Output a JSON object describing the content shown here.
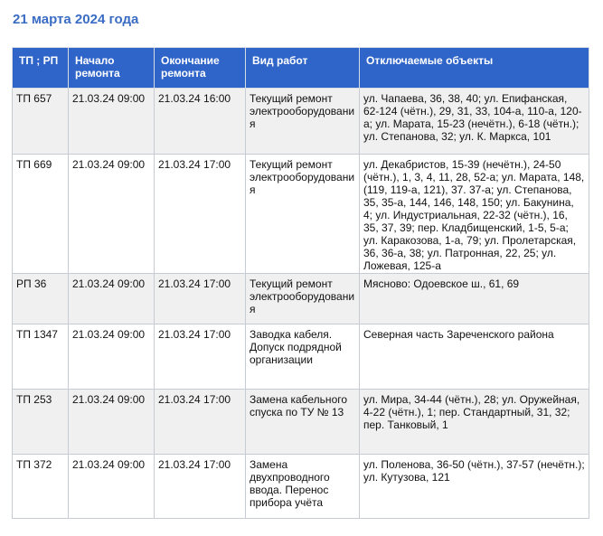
{
  "title": "21 марта 2024 года",
  "table": {
    "headers": [
      "ТП ; РП",
      "Начало ремонта",
      "Окончание ремонта",
      "Вид работ",
      "Отключаемые объекты"
    ],
    "rows": [
      {
        "tp": "ТП 657",
        "start": "21.03.24 09:00",
        "end": "21.03.24 16:00",
        "work": "Текущий ремонт электрооборудования",
        "objects": "ул. Чапаева, 36, 38, 40; ул. Епифанская, 62-124 (чётн.), 29, 31, 33, 104-а, 110-а, 120-а; ул. Марата, 15-23 (нечётн.), 6-18 (чётн.); ул. Степанова, 32; ул. К. Маркса, 101"
      },
      {
        "tp": "ТП 669",
        "start": "21.03.24 09:00",
        "end": "21.03.24 17:00",
        "work": "Текущий ремонт электрооборудования",
        "objects": "ул. Декабристов, 15-39 (нечётн.), 24-50 (чётн.), 1, 3, 4, 11, 28, 52-а; ул. Марата, 148, (119, 119-а, 121), 37. 37-а; ул. Степанова, 35, 35-а, 144, 146, 148, 150; ул. Бакунина, 4; ул. Индустриальная, 22-32 (чётн.), 16, 35, 37, 39; пер. Кладбищенский, 1-5, 5-а; ул. Каракозова, 1-а, 79; ул. Пролетарская, 36, 36-а, 38; ул. Патронная, 22, 25; ул. Ложевая, 125-а"
      },
      {
        "tp": "РП 36",
        "start": "21.03.24 09:00",
        "end": "21.03.24 17:00",
        "work": "Текущий ремонт электрооборудования",
        "objects": "Мясново: Одоевское ш., 61, 69"
      },
      {
        "tp": "ТП 1347",
        "start": "21.03.24 09:00",
        "end": "21.03.24 17:00",
        "work": "Заводка кабеля. Допуск подрядной организации",
        "objects": "Северная часть Зареченского района"
      },
      {
        "tp": "ТП 253",
        "start": "21.03.24 09:00",
        "end": "21.03.24 17:00",
        "work": "Замена кабельного спуска по ТУ № 13",
        "objects": "ул. Мира, 34-44 (чётн.), 28; ул. Оружейная, 4-22 (чётн.), 1; пер. Стандартный, 31, 32; пер. Танковый, 1"
      },
      {
        "tp": "ТП 372",
        "start": "21.03.24 09:00",
        "end": "21.03.24 17:00",
        "work": "Замена двухпроводного ввода. Перенос прибора учёта",
        "objects": "ул. Поленова, 36-50 (чётн.), 37-57 (нечётн.); ул. Кутузова, 121"
      }
    ]
  },
  "colors": {
    "title": "#3a6cc4",
    "header_bg": "#2f64c9",
    "header_text": "#ffffff",
    "row_odd_bg": "#f0f0f0",
    "row_even_bg": "#ffffff"
  }
}
